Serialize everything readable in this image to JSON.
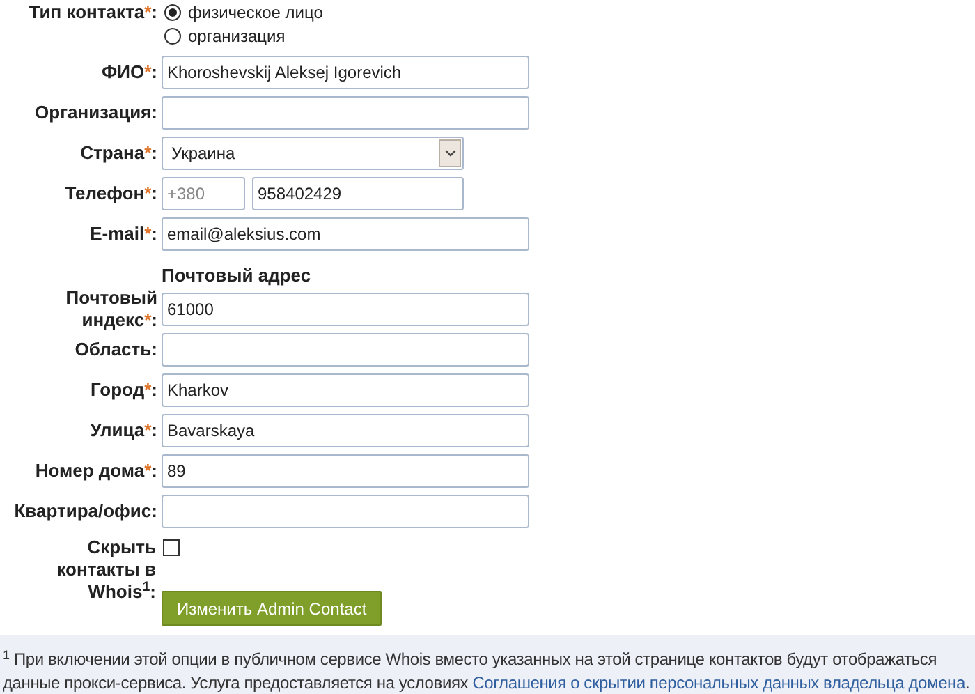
{
  "contact_type": {
    "label": "Тип контакта",
    "required_mark": "*",
    "suffix": ":",
    "options": [
      {
        "label": "физическое лицо",
        "selected": true
      },
      {
        "label": "организация",
        "selected": false
      }
    ]
  },
  "fields": [
    {
      "kind": "text",
      "label": "ФИО",
      "required_mark": "*",
      "suffix": ":",
      "value": "Khoroshevskij Aleksej Igorevich"
    },
    {
      "kind": "text",
      "label": "Организация",
      "suffix": ":"
    },
    {
      "kind": "select",
      "label": "Страна",
      "required_mark": "*",
      "suffix": ":",
      "value": "Украина"
    },
    {
      "kind": "phone",
      "label": "Телефон",
      "required_mark": "*",
      "suffix": ":",
      "code": "+380",
      "value": "958402429"
    },
    {
      "kind": "text",
      "label": "E-mail",
      "required_mark": "*",
      "suffix": ":",
      "value": "email@aleksius.com"
    },
    {
      "kind": "heading",
      "label": "Почтовый адрес"
    },
    {
      "kind": "text",
      "label": "Почтовый индекс",
      "required_mark": "*",
      "suffix": ":",
      "value": "61000"
    },
    {
      "kind": "text",
      "label": "Область",
      "suffix": ":"
    },
    {
      "kind": "text",
      "label": "Город",
      "required_mark": "*",
      "suffix": ":",
      "value": "Kharkov"
    },
    {
      "kind": "text",
      "label": "Улица",
      "required_mark": "*",
      "suffix": ":",
      "value": "Bavarskaya"
    },
    {
      "kind": "text",
      "label": "Номер дома",
      "required_mark": "*",
      "suffix": ":",
      "value": "89"
    },
    {
      "kind": "text",
      "label": "Квартира/офис",
      "suffix": ":"
    },
    {
      "kind": "checkbox",
      "label": "Скрыть контакты в Whois$^{1}$",
      "suffix": ":",
      "checked": false
    }
  ],
  "submit": "Изменить Admin Contact",
  "footnote": {
    "text": "$^{1}$ При включении этой опции в публичном сервисе Whois вместо указанных на этой странице контактов будут отображаться данные прокси-сервиса. Услуга предоставляется на условиях ",
    "link": "Соглашения о скрытии персональных данных владельца домена",
    "end": "."
  }
}
